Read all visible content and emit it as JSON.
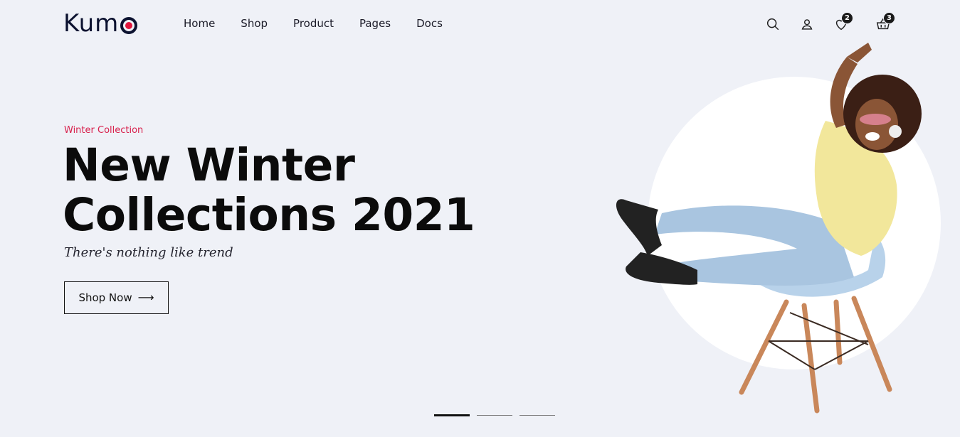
{
  "brand": {
    "logo_text": "Kum",
    "accent": "#e0163c"
  },
  "nav": {
    "items": [
      {
        "label": "Home"
      },
      {
        "label": "Shop"
      },
      {
        "label": "Product"
      },
      {
        "label": "Pages"
      },
      {
        "label": "Docs"
      }
    ]
  },
  "header_icons": {
    "search": "search-icon",
    "account": "user-icon",
    "wishlist": {
      "icon": "heart-icon",
      "count": "2"
    },
    "cart": {
      "icon": "basket-icon",
      "count": "3"
    }
  },
  "hero": {
    "subtitle": "Winter Collection",
    "headline_line1": "New Winter",
    "headline_line2": "Collections 2021",
    "tagline": "There's nothing like trend",
    "cta_label": "Shop Now",
    "cta_icon": "arrow-right-icon"
  },
  "slider": {
    "count": 3,
    "active": 1
  }
}
